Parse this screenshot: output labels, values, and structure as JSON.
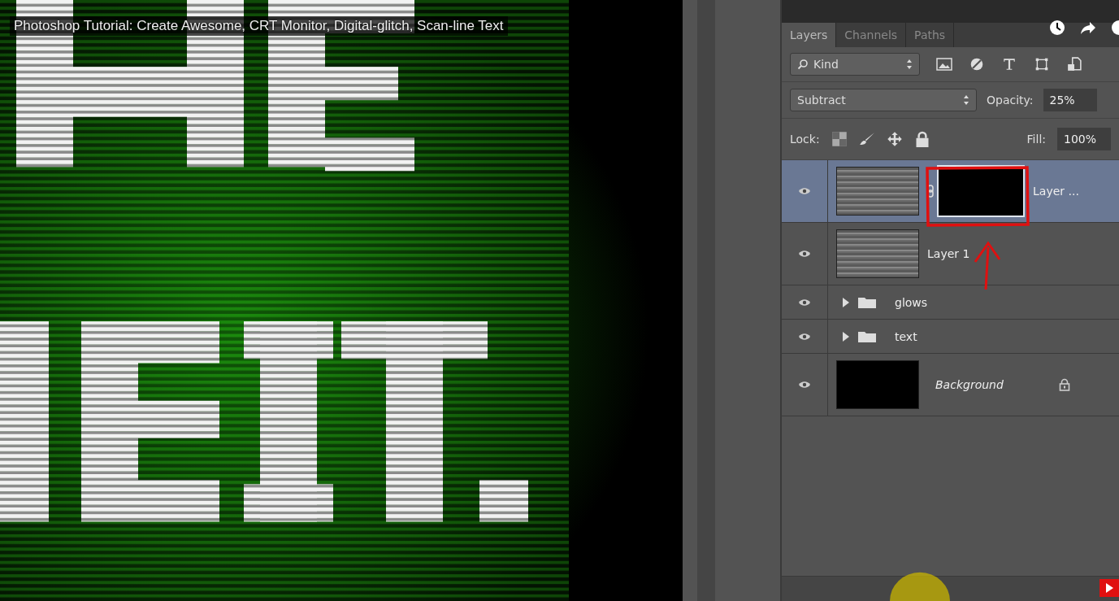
{
  "video_title": "Photoshop Tutorial: Create Awesome, CRT Monitor, Digital-glitch, Scan-line Text",
  "panel_tabs": [
    {
      "label": "Layers",
      "selected": true
    },
    {
      "label": "Channels",
      "selected": false
    },
    {
      "label": "Paths",
      "selected": false
    }
  ],
  "filter": {
    "label": "Kind"
  },
  "blend_mode": {
    "value": "Subtract"
  },
  "opacity": {
    "label": "Opacity:",
    "value": "25%"
  },
  "lock": {
    "label": "Lock:"
  },
  "fill": {
    "label": "Fill:",
    "value": "100%"
  },
  "layers": [
    {
      "kind": "layer",
      "name": "Layer ...",
      "visible": true,
      "selected": true,
      "mask": true
    },
    {
      "kind": "layer",
      "name": "Layer 1",
      "visible": true,
      "selected": false,
      "mask": false
    },
    {
      "kind": "group",
      "name": "glows",
      "visible": true,
      "selected": false,
      "expanded": false
    },
    {
      "kind": "group",
      "name": "text",
      "visible": true,
      "selected": false,
      "expanded": false
    },
    {
      "kind": "background",
      "name": "Background",
      "visible": true,
      "selected": false,
      "locked": true
    }
  ]
}
